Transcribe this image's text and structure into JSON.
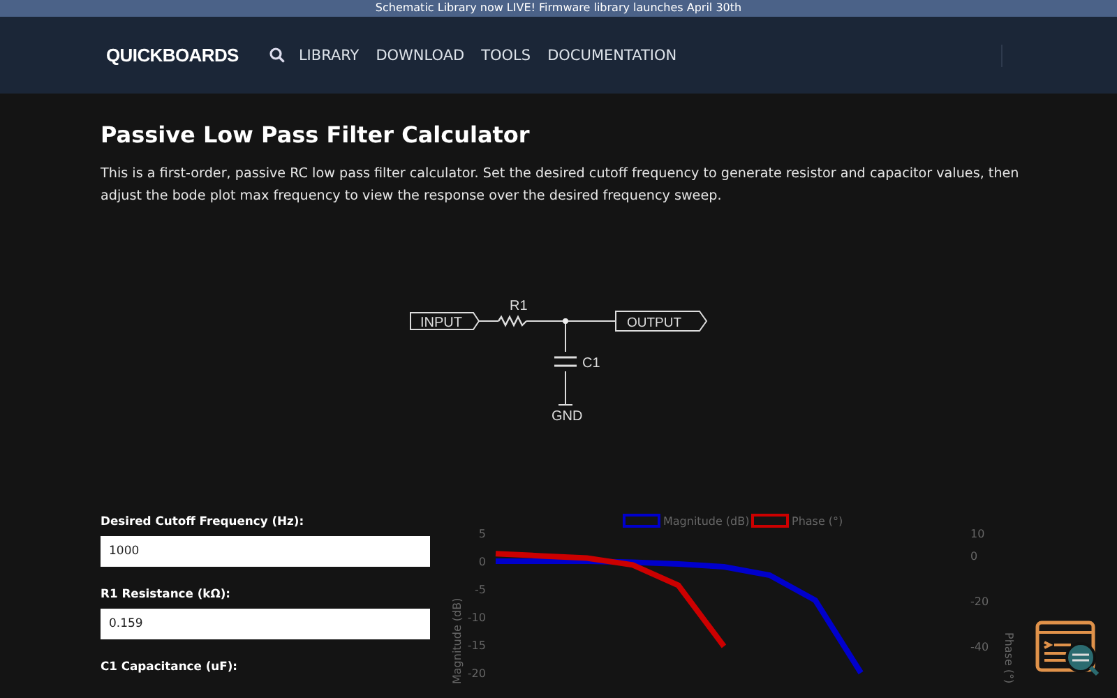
{
  "announcement": "Schematic Library now LIVE! Firmware library launches April 30th",
  "nav": {
    "logo": "QUICKBOARDS",
    "items": [
      {
        "label": "LIBRARY"
      },
      {
        "label": "DOWNLOAD"
      },
      {
        "label": "TOOLS"
      },
      {
        "label": "DOCUMENTATION"
      }
    ]
  },
  "page": {
    "title": "Passive Low Pass Filter Calculator",
    "description": "This is a first-order, passive RC low pass filter calculator. Set the desired cutoff frequency to generate resistor and capacitor values, then adjust the bode plot max frequency to view the response over the desired frequency sweep."
  },
  "schematic": {
    "input": "INPUT",
    "resistor": "R1",
    "output": "OUTPUT",
    "capacitor": "C1",
    "ground": "GND"
  },
  "fields": [
    {
      "label": "Desired Cutoff Frequency (Hz):",
      "value": "1000"
    },
    {
      "label": "R1 Resistance (kΩ):",
      "value": "0.159"
    },
    {
      "label": "C1 Capacitance (uF):"
    }
  ],
  "chart_data": {
    "type": "line",
    "ylabel": "Magnitude (dB)",
    "y2label": "Phase (°)",
    "legend": "top",
    "ylim": [
      -20,
      5
    ],
    "y2lim": [
      -40,
      10
    ],
    "yticks": [
      5,
      0,
      -5,
      -10,
      -15,
      -20
    ],
    "y2ticks": [
      10,
      0,
      -20,
      -40
    ],
    "series": [
      {
        "name": "Magnitude (dB)",
        "color": "#0000cc",
        "axis": "y",
        "values": [
          0,
          0,
          0,
          -0.2,
          -0.5,
          -1,
          -2.5,
          -7,
          -20
        ]
      },
      {
        "name": "Phase (°)",
        "color": "#cc0000",
        "axis": "y2",
        "values": [
          1,
          0,
          -1,
          -4,
          -13,
          -40
        ]
      }
    ]
  }
}
